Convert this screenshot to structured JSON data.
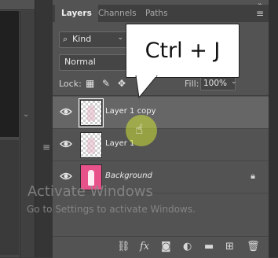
{
  "tabs": [
    {
      "label": "Layers",
      "active": true
    },
    {
      "label": "Channels",
      "active": false
    },
    {
      "label": "Paths",
      "active": false
    }
  ],
  "filter": {
    "kind_label": "Kind",
    "icon": "search-icon"
  },
  "blend_mode": "Normal",
  "lock": {
    "label": "Lock:"
  },
  "fill": {
    "label": "Fill:",
    "value": "100%"
  },
  "layers": [
    {
      "name": "Layer 1 copy",
      "selected": true,
      "italic": false,
      "visible": true
    },
    {
      "name": "Layer 1",
      "selected": false,
      "italic": false,
      "visible": true
    },
    {
      "name": "Background",
      "selected": false,
      "italic": true,
      "visible": true,
      "locked": true
    }
  ],
  "callout": {
    "text": "Ctrl + J"
  },
  "watermark": {
    "title": "Activate Windows",
    "subtitle": "Go to Settings to activate Windows."
  },
  "colors": {
    "panel": "#535353",
    "selected_row": "#666666",
    "accent_highlight": "#cde137",
    "background_thumb": "#e8528a"
  }
}
